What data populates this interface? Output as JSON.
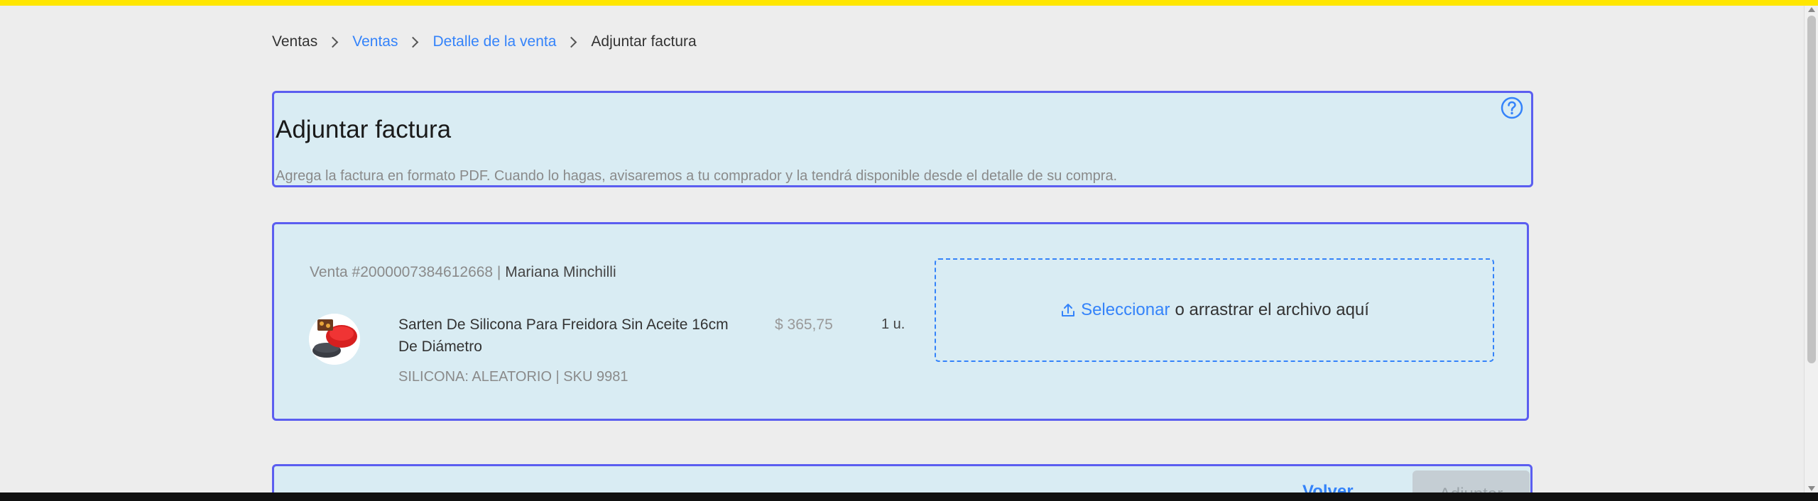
{
  "breadcrumb": {
    "items": [
      {
        "label": "Ventas"
      },
      {
        "label": "Ventas"
      },
      {
        "label": "Detalle de la venta"
      },
      {
        "label": "Adjuntar factura"
      }
    ]
  },
  "header": {
    "title": "Adjuntar factura",
    "subtitle": "Agrega la factura en formato PDF. Cuando lo hagas, avisaremos a tu comprador y la tendrá disponible desde el detalle de su compra.",
    "help_icon": "question-circle-icon"
  },
  "sale": {
    "order_label": "Venta #2000007384612668 | ",
    "buyer_name": "Mariana Minchilli",
    "product": {
      "title": "Sarten De Silicona Para Freidora Sin Aceite 16cm De Diámetro",
      "variant": "SILICONA: ALEATORIO | SKU 9981",
      "price": "$ 365,75",
      "quantity": "1 u."
    }
  },
  "dropzone": {
    "icon": "upload-icon",
    "select_label": "Seleccionar",
    "rest_label": "o arrastrar el archivo aquí"
  },
  "actions": {
    "back_label": "Volver",
    "attach_label": "Adjuntar"
  },
  "colors": {
    "topbar": "#ffe600",
    "accent": "#3483fa",
    "card_border": "#5b5ef0",
    "card_bg": "#d9ecf3"
  }
}
